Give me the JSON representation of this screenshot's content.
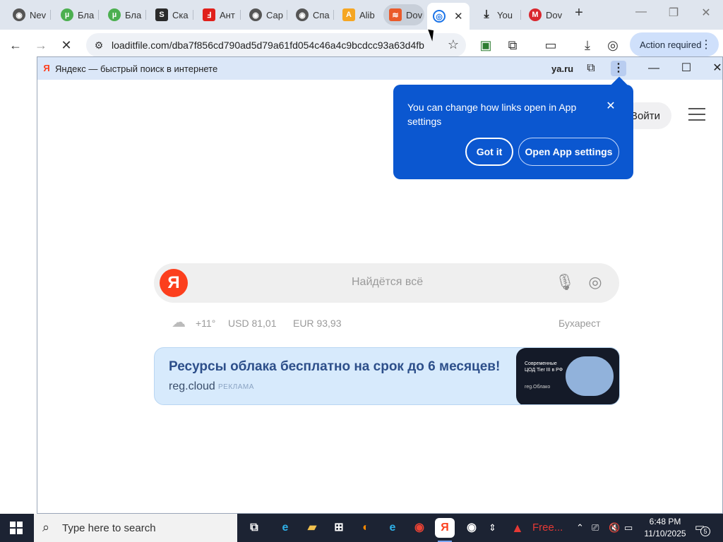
{
  "browser": {
    "tabs": [
      {
        "label": "Nev",
        "icon": "chrome-icon",
        "color": "#555555",
        "glyph": ""
      },
      {
        "label": "Бла",
        "icon": "utorrent-icon",
        "color": "#4caf50",
        "glyph": "µ"
      },
      {
        "label": "Бла",
        "icon": "utorrent-icon",
        "color": "#4caf50",
        "glyph": "µ"
      },
      {
        "label": "Ска",
        "icon": "s-app-icon",
        "color": "#2b2b2b",
        "glyph": "S"
      },
      {
        "label": "Ант",
        "icon": "adobe-icon",
        "color": "#e0201b",
        "glyph": "Ⅎ"
      },
      {
        "label": "Сар",
        "icon": "chrome-icon",
        "color": "#555555",
        "glyph": ""
      },
      {
        "label": "Спа",
        "icon": "chrome-icon",
        "color": "#555555",
        "glyph": ""
      },
      {
        "label": "Alib",
        "icon": "aliexpress-icon",
        "color": "#f5a623",
        "glyph": "A"
      },
      {
        "label": "Dov",
        "icon": "layers-icon",
        "color": "#ea5a2a",
        "glyph": "≋"
      },
      {
        "label": "",
        "icon": "loading-icon",
        "color": "#1a73e8",
        "glyph": "◎"
      },
      {
        "label": "You",
        "icon": "download-icon",
        "color": "#222222",
        "glyph": "⤓"
      },
      {
        "label": "Dov",
        "icon": "mega-icon",
        "color": "#d9272e",
        "glyph": "M"
      }
    ],
    "url": "loaditfile.com/dba7f856cd790ad5d79a61fd054c46a4c9bcdcc93a63d4fb",
    "action_required": "Action required"
  },
  "app_window": {
    "title": "Яндекс — быстрый поиск в интернете",
    "domain": "ya.ru"
  },
  "yandex": {
    "login": "Войти",
    "logo_letter": "Я",
    "search_placeholder": "Найдётся всё",
    "temperature": "+11°",
    "usd": "USD  81,01",
    "eur": "EUR  93,93",
    "city": "Бухарест",
    "ad": {
      "headline": "Ресурсы облака бесплатно на срок до 6 месяцев!",
      "domain": "reg.cloud",
      "marker": "РЕКЛАМА",
      "banner_text": "Современные ЦОД Tier III в РФ",
      "banner_brand": "reg.Облако"
    }
  },
  "popup": {
    "message": "You can change how links open in App settings",
    "got_it": "Got it",
    "open_settings": "Open App settings",
    "color": "#0b57d0"
  },
  "taskbar": {
    "search_placeholder": "Type here to search",
    "tray_app": "Free...",
    "time": "6:48 PM",
    "date": "11/10/2025",
    "notifications": "5"
  }
}
